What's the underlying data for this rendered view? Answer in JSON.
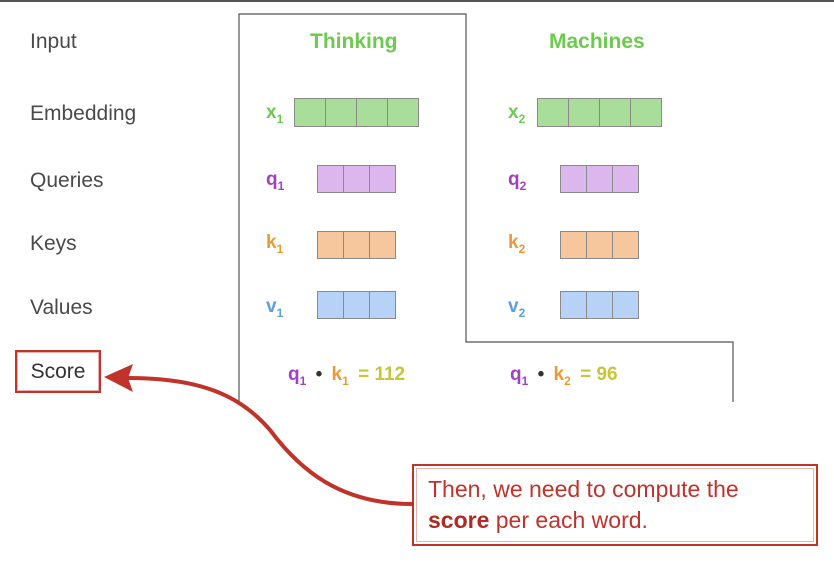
{
  "row_labels": {
    "input": "Input",
    "embedding": "Embedding",
    "queries": "Queries",
    "keys": "Keys",
    "values": "Values",
    "score": "Score"
  },
  "words": [
    {
      "word": "Thinking",
      "embedding": {
        "sym": "x",
        "sub": "1"
      },
      "query": {
        "sym": "q",
        "sub": "1"
      },
      "key": {
        "sym": "k",
        "sub": "1"
      },
      "value": {
        "sym": "v",
        "sub": "1"
      },
      "score": {
        "q": "q",
        "q_sub": "1",
        "dot": "•",
        "k": "k",
        "k_sub": "1",
        "eq": "=",
        "val": "112"
      }
    },
    {
      "word": "Machines",
      "embedding": {
        "sym": "x",
        "sub": "2"
      },
      "query": {
        "sym": "q",
        "sub": "2"
      },
      "key": {
        "sym": "k",
        "sub": "2"
      },
      "value": {
        "sym": "v",
        "sub": "2"
      },
      "score": {
        "q": "q",
        "q_sub": "1",
        "dot": "•",
        "k": "k",
        "k_sub": "2",
        "eq": "=",
        "val": "96"
      }
    }
  ],
  "callout": {
    "line1": "Then, we need to compute the",
    "bold": "score",
    "line2_rest": " per each word."
  },
  "colors": {
    "word": "#6ccb4e",
    "embedding_fill": "#a9dd9a",
    "query": "#a43fc4",
    "query_fill": "#dcb7ee",
    "key": "#eb9a34",
    "key_fill": "#f6c79d",
    "value": "#5b9ee6",
    "value_fill": "#b6d3f7",
    "score_value": "#c9c53a",
    "accent_red": "#c0332a"
  }
}
